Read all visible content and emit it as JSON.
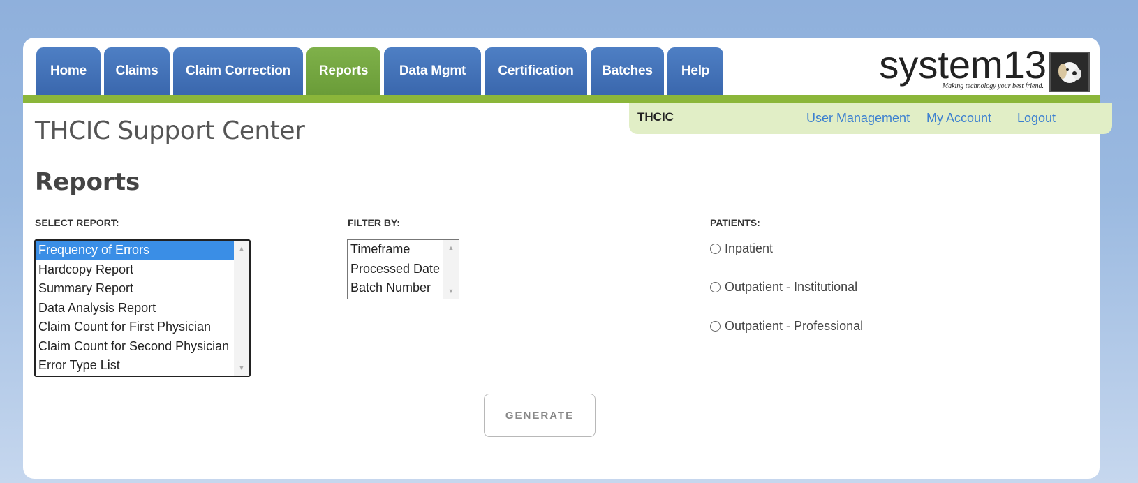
{
  "nav": {
    "tabs": [
      {
        "label": "Home"
      },
      {
        "label": "Claims"
      },
      {
        "label": "Claim Correction"
      },
      {
        "label": "Reports",
        "active": true
      },
      {
        "label": "Data Mgmt"
      },
      {
        "label": "Certification"
      },
      {
        "label": "Batches"
      },
      {
        "label": "Help"
      }
    ]
  },
  "logo": {
    "text": "system13",
    "tagline": "Making technology your best friend.",
    "icon": "dog-icon"
  },
  "userbar": {
    "org": "THCIC",
    "user_management": "User Management",
    "my_account": "My Account",
    "logout": "Logout"
  },
  "site_title": "THCIC Support Center",
  "page_title": "Reports",
  "select_report": {
    "label": "SELECT REPORT:",
    "options": [
      "Frequency of Errors",
      "Hardcopy Report",
      "Summary Report",
      "Data Analysis Report",
      "Claim Count for First Physician",
      "Claim Count for Second Physician",
      "Error Type List"
    ],
    "selected": "Frequency of Errors"
  },
  "filter_by": {
    "label": "FILTER BY:",
    "options": [
      "Timeframe",
      "Processed Date",
      "Batch Number"
    ]
  },
  "patients": {
    "label": "PATIENTS:",
    "options": [
      "Inpatient",
      "Outpatient - Institutional",
      "Outpatient - Professional"
    ]
  },
  "generate_label": "GENERATE",
  "colors": {
    "tab_blue": "#3a67ad",
    "tab_green": "#6a9c38",
    "accent_bar": "#8bb63a",
    "link": "#3b7fd0",
    "selection": "#3a8ee6"
  }
}
